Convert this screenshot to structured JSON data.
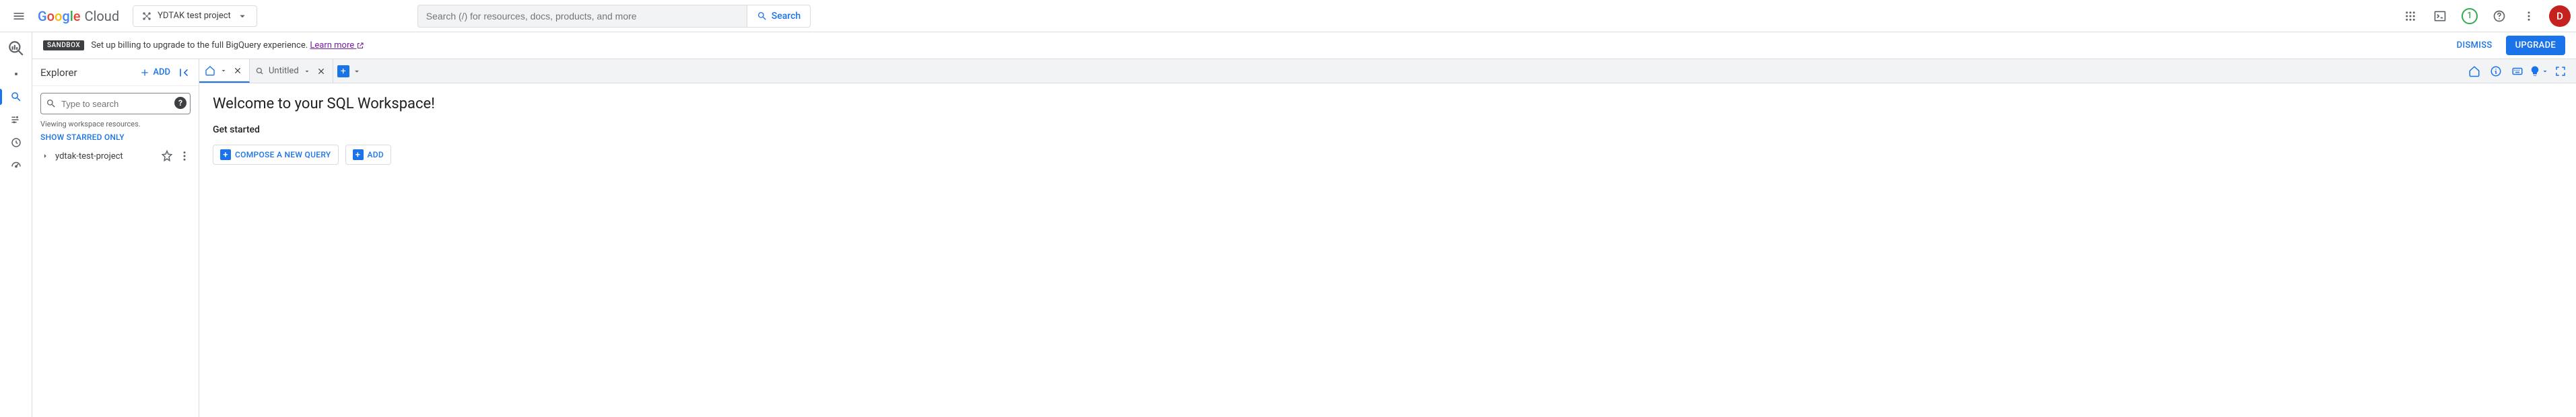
{
  "header": {
    "logo_cloud": "Cloud",
    "project_name": "YDTAK test project",
    "search_placeholder": "Search (/) for resources, docs, products, and more",
    "search_button": "Search",
    "trial_number": "1",
    "avatar_letter": "D"
  },
  "banner": {
    "chip": "SANDBOX",
    "text": "Set up billing to upgrade to the full BigQuery experience. ",
    "link": "Learn more",
    "dismiss": "DISMISS",
    "upgrade": "UPGRADE"
  },
  "explorer": {
    "title": "Explorer",
    "add": "ADD",
    "search_placeholder": "Type to search",
    "viewing": "Viewing workspace resources.",
    "starred": "SHOW STARRED ONLY",
    "project": "ydtak-test-project"
  },
  "tabs": {
    "untitled": "Untitled"
  },
  "workspace": {
    "title": "Welcome to your SQL Workspace!",
    "subtitle": "Get started",
    "compose": "COMPOSE A NEW QUERY",
    "add": "ADD"
  }
}
